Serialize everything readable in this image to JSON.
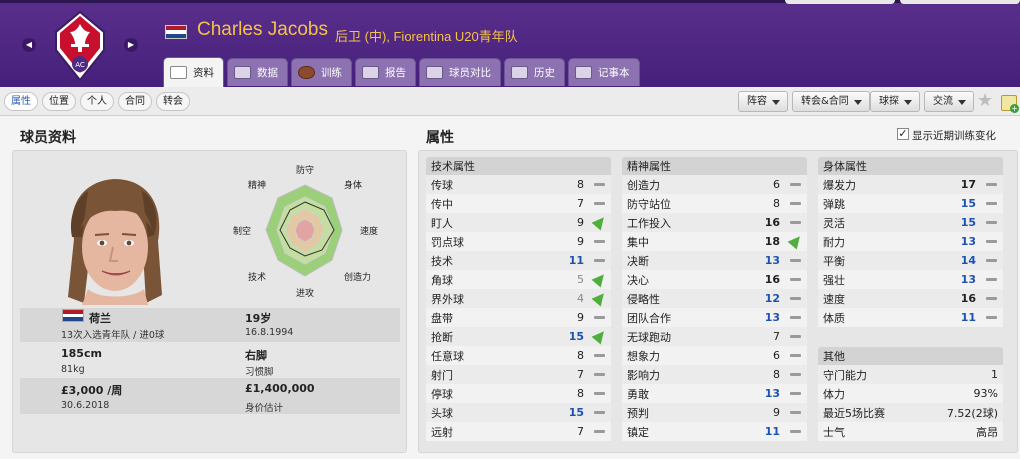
{
  "header": {
    "player_name": "Charles Jacobs",
    "role": "后卫 (中), Fiorentina U20青年队",
    "tabs": [
      "资料",
      "数据",
      "训练",
      "报告",
      "球员对比",
      "历史",
      "记事本"
    ]
  },
  "toolbar": {
    "sub_tabs": [
      "属性",
      "位置",
      "个人",
      "合同",
      "转会"
    ],
    "dropdowns": [
      "阵容",
      "转会&合同",
      "球探",
      "交流"
    ]
  },
  "left": {
    "title": "球员资料",
    "radar_labels": [
      "防守",
      "身体",
      "速度",
      "创造力",
      "进攻",
      "技术",
      "制空",
      "精神"
    ],
    "nationality": "荷兰",
    "caps": "13次入选青年队 / 进0球",
    "age": "19岁",
    "dob": "16.8.1994",
    "height": "185cm",
    "weight": "81kg",
    "foot": "右脚",
    "foot_label": "习惯脚",
    "wage": "£3,000 /周",
    "contract_end": "30.6.2018",
    "value": "£1,400,000",
    "value_label": "身价估计"
  },
  "right": {
    "title": "属性",
    "train_label": "显示近期训练变化",
    "technical": {
      "header": "技术属性",
      "rows": [
        {
          "name": "传球",
          "value": "8",
          "trend": "flat",
          "tone": "n"
        },
        {
          "name": "传中",
          "value": "7",
          "trend": "flat",
          "tone": "n"
        },
        {
          "name": "盯人",
          "value": "9",
          "trend": "up",
          "tone": "n"
        },
        {
          "name": "罚点球",
          "value": "9",
          "trend": "flat",
          "tone": "n"
        },
        {
          "name": "技术",
          "value": "11",
          "trend": "flat",
          "tone": "b"
        },
        {
          "name": "角球",
          "value": "5",
          "trend": "up",
          "tone": "g"
        },
        {
          "name": "界外球",
          "value": "4",
          "trend": "up",
          "tone": "g"
        },
        {
          "name": "盘带",
          "value": "9",
          "trend": "flat",
          "tone": "n"
        },
        {
          "name": "抢断",
          "value": "15",
          "trend": "up",
          "tone": "b"
        },
        {
          "name": "任意球",
          "value": "8",
          "trend": "flat",
          "tone": "n"
        },
        {
          "name": "射门",
          "value": "7",
          "trend": "flat",
          "tone": "n"
        },
        {
          "name": "停球",
          "value": "8",
          "trend": "flat",
          "tone": "n"
        },
        {
          "name": "头球",
          "value": "15",
          "trend": "flat",
          "tone": "b"
        },
        {
          "name": "远射",
          "value": "7",
          "trend": "flat",
          "tone": "n"
        }
      ]
    },
    "mental": {
      "header": "精神属性",
      "rows": [
        {
          "name": "创造力",
          "value": "6",
          "trend": "flat",
          "tone": "n"
        },
        {
          "name": "防守站位",
          "value": "8",
          "trend": "flat",
          "tone": "n"
        },
        {
          "name": "工作投入",
          "value": "16",
          "trend": "flat",
          "tone": "k"
        },
        {
          "name": "集中",
          "value": "18",
          "trend": "up",
          "tone": "k"
        },
        {
          "name": "决断",
          "value": "13",
          "trend": "flat",
          "tone": "b"
        },
        {
          "name": "决心",
          "value": "16",
          "trend": "flat",
          "tone": "k"
        },
        {
          "name": "侵略性",
          "value": "12",
          "trend": "flat",
          "tone": "b"
        },
        {
          "name": "团队合作",
          "value": "13",
          "trend": "flat",
          "tone": "b"
        },
        {
          "name": "无球跑动",
          "value": "7",
          "trend": "flat",
          "tone": "n"
        },
        {
          "name": "想象力",
          "value": "6",
          "trend": "flat",
          "tone": "n"
        },
        {
          "name": "影响力",
          "value": "8",
          "trend": "flat",
          "tone": "n"
        },
        {
          "name": "勇敢",
          "value": "13",
          "trend": "flat",
          "tone": "b"
        },
        {
          "name": "预判",
          "value": "9",
          "trend": "flat",
          "tone": "n"
        },
        {
          "name": "镇定",
          "value": "11",
          "trend": "flat",
          "tone": "b"
        }
      ]
    },
    "physical": {
      "header": "身体属性",
      "rows": [
        {
          "name": "爆发力",
          "value": "17",
          "trend": "flat",
          "tone": "k"
        },
        {
          "name": "弹跳",
          "value": "15",
          "trend": "flat",
          "tone": "b"
        },
        {
          "name": "灵活",
          "value": "15",
          "trend": "flat",
          "tone": "b"
        },
        {
          "name": "耐力",
          "value": "13",
          "trend": "flat",
          "tone": "b"
        },
        {
          "name": "平衡",
          "value": "14",
          "trend": "flat",
          "tone": "b"
        },
        {
          "name": "强壮",
          "value": "13",
          "trend": "flat",
          "tone": "b"
        },
        {
          "name": "速度",
          "value": "16",
          "trend": "flat",
          "tone": "k"
        },
        {
          "name": "体质",
          "value": "11",
          "trend": "flat",
          "tone": "b"
        }
      ]
    },
    "other": {
      "header": "其他",
      "rows": [
        {
          "name": "守门能力",
          "value": "1"
        },
        {
          "name": "体力",
          "value": "93%"
        },
        {
          "name": "最近5场比赛",
          "value": "7.52(2球)"
        },
        {
          "name": "士气",
          "value": "高昂"
        }
      ]
    }
  },
  "colors": {
    "header": "#4e2a84",
    "accent_gold": "#f5c24a",
    "blue_value": "#1d52b3",
    "trend_up": "#4fae3d"
  }
}
